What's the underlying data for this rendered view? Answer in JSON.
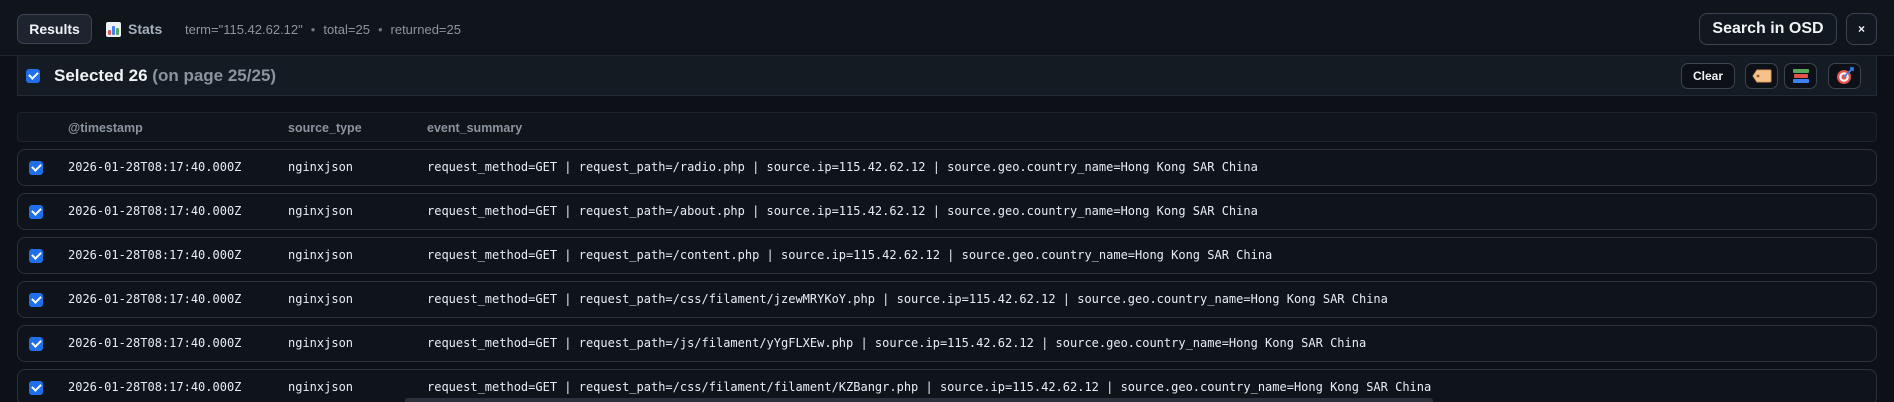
{
  "header": {
    "tab_results": "Results",
    "tab_stats": "Stats",
    "term": "term=\"115.42.62.12\"",
    "total": "total=25",
    "returned": "returned=25",
    "separator": "•",
    "search_osd": "Search in OSD",
    "close": "×"
  },
  "selection": {
    "count_label": "Selected 26",
    "page_label": "(on page 25/25)",
    "clear_label": "Clear",
    "actions": [
      "tag-icon",
      "books-icon",
      "target-icon"
    ]
  },
  "table": {
    "columns": [
      "@timestamp",
      "source_type",
      "event_summary"
    ],
    "rows": [
      {
        "timestamp": "2026-01-28T08:17:40.000Z",
        "source_type": "nginxjson",
        "summary": "request_method=GET | request_path=/radio.php | source.ip=115.42.62.12 | source.geo.country_name=Hong Kong SAR China"
      },
      {
        "timestamp": "2026-01-28T08:17:40.000Z",
        "source_type": "nginxjson",
        "summary": "request_method=GET | request_path=/about.php | source.ip=115.42.62.12 | source.geo.country_name=Hong Kong SAR China"
      },
      {
        "timestamp": "2026-01-28T08:17:40.000Z",
        "source_type": "nginxjson",
        "summary": "request_method=GET | request_path=/content.php | source.ip=115.42.62.12 | source.geo.country_name=Hong Kong SAR China"
      },
      {
        "timestamp": "2026-01-28T08:17:40.000Z",
        "source_type": "nginxjson",
        "summary": "request_method=GET | request_path=/css/filament/jzewMRYKoY.php | source.ip=115.42.62.12 | source.geo.country_name=Hong Kong SAR China"
      },
      {
        "timestamp": "2026-01-28T08:17:40.000Z",
        "source_type": "nginxjson",
        "summary": "request_method=GET | request_path=/js/filament/yYgFLXEw.php | source.ip=115.42.62.12 | source.geo.country_name=Hong Kong SAR China"
      },
      {
        "timestamp": "2026-01-28T08:17:40.000Z",
        "source_type": "nginxjson",
        "summary": "request_method=GET | request_path=/css/filament/filament/KZBangr.php | source.ip=115.42.62.12 | source.geo.country_name=Hong Kong SAR China"
      }
    ]
  },
  "colors": {
    "accent": "#1f6feb",
    "background": "#0d1117",
    "border": "#2a3139"
  }
}
